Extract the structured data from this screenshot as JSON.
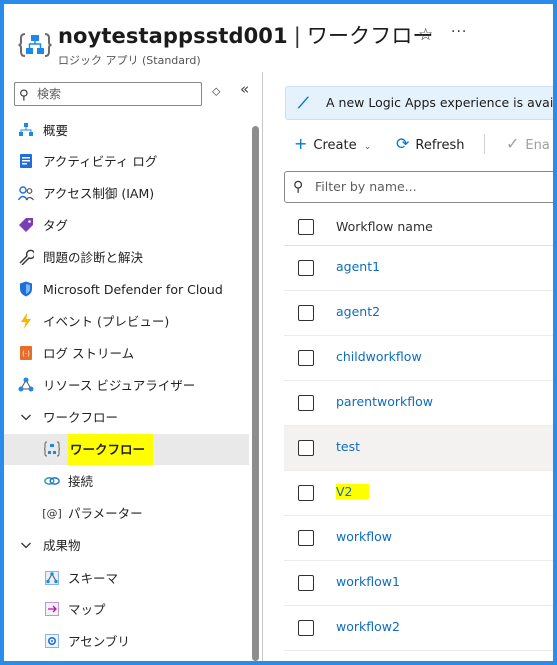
{
  "header": {
    "resource_name": "noytestappsstd001",
    "separator": "|",
    "page_title": "ワークフロー",
    "subtitle": "ロジック アプリ (Standard)",
    "favorite_icon": "☆",
    "more_icon": "···"
  },
  "sidebar": {
    "search_placeholder": "検索",
    "items": [
      {
        "label": "概要",
        "icon": "overview-icon"
      },
      {
        "label": "アクティビティ ログ",
        "icon": "activity-log-icon"
      },
      {
        "label": "アクセス制御 (IAM)",
        "icon": "iam-icon"
      },
      {
        "label": "タグ",
        "icon": "tag-icon"
      },
      {
        "label": "問題の診断と解決",
        "icon": "wrench-icon"
      },
      {
        "label": "Microsoft Defender for Cloud",
        "icon": "shield-icon"
      },
      {
        "label": "イベント (プレビュー)",
        "icon": "lightning-icon"
      },
      {
        "label": "ログ ストリーム",
        "icon": "log-stream-icon"
      },
      {
        "label": "リソース ビジュアライザー",
        "icon": "visualizer-icon"
      },
      {
        "label": "ワークフロー",
        "icon": "chevron-down-icon"
      },
      {
        "label": "ワークフロー",
        "icon": "workflow-icon"
      },
      {
        "label": "接続",
        "icon": "link-icon"
      },
      {
        "label": "パラメーター",
        "icon": "parameter-icon"
      },
      {
        "label": "成果物",
        "icon": "chevron-down-icon"
      },
      {
        "label": "スキーマ",
        "icon": "schema-icon"
      },
      {
        "label": "マップ",
        "icon": "map-icon"
      },
      {
        "label": "アセンブリ",
        "icon": "assembly-icon"
      }
    ]
  },
  "main": {
    "banner_text": "A new Logic Apps experience is avai",
    "toolbar": {
      "create": "Create",
      "refresh": "Refresh",
      "enable": "Ena"
    },
    "filter_placeholder": "Filter by name...",
    "column_header": "Workflow name",
    "workflows": [
      "agent1",
      "agent2",
      "childworkflow",
      "parentworkflow",
      "test",
      "V2",
      "workflow",
      "workflow1",
      "workflow2"
    ]
  },
  "colors": {
    "frame_border": "#2a8ce8",
    "link": "#0f6cbd",
    "highlight": "#ffff00",
    "accent": "#0078d4"
  }
}
